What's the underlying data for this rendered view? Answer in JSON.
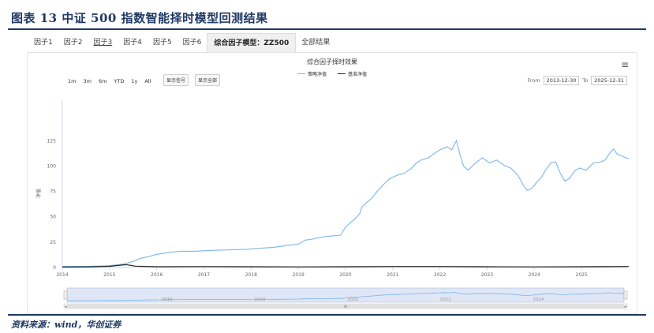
{
  "figure": {
    "title": "图表 13   中证 500 指数智能择时模型回测结果",
    "source": "资料来源：wind，华创证券"
  },
  "tabs": [
    {
      "label": "因子1",
      "underline": false,
      "active": false
    },
    {
      "label": "因子2",
      "underline": false,
      "active": false
    },
    {
      "label": "因子3",
      "underline": true,
      "active": false
    },
    {
      "label": "因子4",
      "underline": false,
      "active": false
    },
    {
      "label": "因子5",
      "underline": false,
      "active": false
    },
    {
      "label": "因子6",
      "underline": false,
      "active": false
    },
    {
      "label": "综合因子模型：ZZ500",
      "underline": false,
      "active": true
    },
    {
      "label": "全部结果",
      "underline": false,
      "active": false
    }
  ],
  "toolbar": {
    "zoom_buttons": [
      "1m",
      "3m",
      "6m",
      "YTD",
      "1y",
      "All"
    ],
    "show_signal_label": "显示信号",
    "show_all_label": "显示全部",
    "from_label": "From",
    "from_value": "2013-12-30",
    "to_label": "To",
    "to_value": "2025-12-31",
    "menu_icon": "hamburger-menu-icon"
  },
  "colors": {
    "strategy": "#7cb5ec",
    "benchmark": "#222222",
    "title": "#1f3864",
    "navigator_fill": "#c9d6ef"
  },
  "chart_data": {
    "type": "line",
    "title": "综合因子择时效果",
    "ylabel": "净值",
    "ylim": [
      0,
      140
    ],
    "yticks": [
      0,
      25,
      50,
      75,
      100,
      125
    ],
    "xlim": [
      2014.0,
      2026.0
    ],
    "xticks": [
      "2014",
      "2015",
      "2016",
      "2017",
      "2018",
      "2019",
      "2020",
      "2021",
      "2022",
      "2023",
      "2024",
      "2025"
    ],
    "navigator_ticks": [
      "2016",
      "2018",
      "2020",
      "2022",
      "2024"
    ],
    "legend_position": "top-center",
    "grid": false,
    "series": [
      {
        "name": "策略净值",
        "points": [
          [
            2014.0,
            1.0
          ],
          [
            2014.5,
            1.2
          ],
          [
            2015.0,
            1.8
          ],
          [
            2015.3,
            3.5
          ],
          [
            2015.5,
            6
          ],
          [
            2015.65,
            9
          ],
          [
            2015.85,
            11
          ],
          [
            2016.0,
            13
          ],
          [
            2016.3,
            15
          ],
          [
            2016.5,
            16
          ],
          [
            2016.8,
            16
          ],
          [
            2017.0,
            16.5
          ],
          [
            2017.3,
            17
          ],
          [
            2017.6,
            17.5
          ],
          [
            2017.9,
            18
          ],
          [
            2018.2,
            19
          ],
          [
            2018.5,
            20
          ],
          [
            2018.8,
            22
          ],
          [
            2019.0,
            23
          ],
          [
            2019.15,
            27
          ],
          [
            2019.3,
            28
          ],
          [
            2019.5,
            30
          ],
          [
            2019.7,
            31
          ],
          [
            2019.9,
            32
          ],
          [
            2020.0,
            40
          ],
          [
            2020.1,
            44
          ],
          [
            2020.2,
            48
          ],
          [
            2020.3,
            53
          ],
          [
            2020.35,
            60
          ],
          [
            2020.45,
            64
          ],
          [
            2020.55,
            68
          ],
          [
            2020.65,
            74
          ],
          [
            2020.75,
            79
          ],
          [
            2020.85,
            84
          ],
          [
            2020.95,
            88
          ],
          [
            2021.1,
            91
          ],
          [
            2021.25,
            93
          ],
          [
            2021.4,
            98
          ],
          [
            2021.5,
            103
          ],
          [
            2021.6,
            106
          ],
          [
            2021.75,
            108
          ],
          [
            2021.9,
            113
          ],
          [
            2022.0,
            116
          ],
          [
            2022.15,
            119
          ],
          [
            2022.25,
            116
          ],
          [
            2022.35,
            125
          ],
          [
            2022.42,
            112
          ],
          [
            2022.5,
            100
          ],
          [
            2022.6,
            96
          ],
          [
            2022.75,
            103
          ],
          [
            2022.9,
            108
          ],
          [
            2023.05,
            103
          ],
          [
            2023.2,
            106
          ],
          [
            2023.35,
            101
          ],
          [
            2023.5,
            98
          ],
          [
            2023.65,
            91
          ],
          [
            2023.78,
            80
          ],
          [
            2023.85,
            76
          ],
          [
            2023.95,
            78
          ],
          [
            2024.05,
            84
          ],
          [
            2024.15,
            89
          ],
          [
            2024.25,
            97
          ],
          [
            2024.35,
            103
          ],
          [
            2024.45,
            104
          ],
          [
            2024.55,
            93
          ],
          [
            2024.65,
            85
          ],
          [
            2024.75,
            88
          ],
          [
            2024.85,
            95
          ],
          [
            2024.95,
            98
          ],
          [
            2025.1,
            96
          ],
          [
            2025.25,
            103
          ],
          [
            2025.4,
            104
          ],
          [
            2025.5,
            106
          ],
          [
            2025.6,
            113
          ],
          [
            2025.68,
            117
          ],
          [
            2025.75,
            112
          ],
          [
            2025.85,
            110
          ],
          [
            2025.95,
            108
          ],
          [
            2026.0,
            107
          ]
        ]
      },
      {
        "name": "基准净值",
        "points": [
          [
            2014.0,
            0.5
          ],
          [
            2014.6,
            0.7
          ],
          [
            2015.0,
            1.2
          ],
          [
            2015.35,
            2.8
          ],
          [
            2015.55,
            1.3
          ],
          [
            2016.0,
            0.8
          ],
          [
            2017.0,
            0.9
          ],
          [
            2018.0,
            0.8
          ],
          [
            2019.0,
            0.6
          ],
          [
            2020.0,
            0.8
          ],
          [
            2021.0,
            1.0
          ],
          [
            2022.0,
            1.0
          ],
          [
            2023.0,
            0.8
          ],
          [
            2024.0,
            0.6
          ],
          [
            2025.0,
            0.8
          ],
          [
            2026.0,
            1.0
          ]
        ]
      }
    ]
  }
}
